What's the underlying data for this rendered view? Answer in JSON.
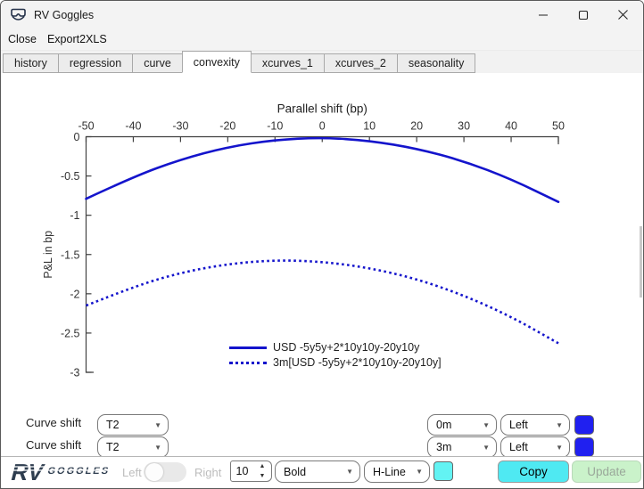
{
  "window": {
    "title": "RV Goggles"
  },
  "menu": {
    "items": [
      {
        "label": "Close"
      },
      {
        "label": "Export2XLS"
      }
    ]
  },
  "tabs": {
    "active_index": 3,
    "items": [
      {
        "label": "history"
      },
      {
        "label": "regression"
      },
      {
        "label": "curve"
      },
      {
        "label": "convexity"
      },
      {
        "label": "xcurves_1"
      },
      {
        "label": "xcurves_2"
      },
      {
        "label": "seasonality"
      }
    ]
  },
  "chart_data": {
    "type": "line",
    "title": "Parallel shift (bp)",
    "xlabel": "Parallel shift (bp)",
    "ylabel": "P&L in bp",
    "x_axis_position": "top",
    "grid": false,
    "xlim": [
      -50,
      50
    ],
    "ylim": [
      -3,
      0
    ],
    "xticks": [
      -50,
      -40,
      -30,
      -20,
      -10,
      0,
      10,
      20,
      30,
      40,
      50
    ],
    "yticks": [
      0,
      -0.5,
      -1,
      -1.5,
      -2,
      -2.5,
      -3
    ],
    "x": [
      -50,
      -40,
      -30,
      -20,
      -10,
      0,
      10,
      20,
      30,
      40,
      50
    ],
    "series": [
      {
        "name": "USD -5y5y+2*10y10y-20y10y",
        "style": "solid",
        "color": "#1414cc",
        "values": [
          -0.79,
          -0.51,
          -0.29,
          -0.13,
          -0.04,
          -0.01,
          -0.05,
          -0.15,
          -0.31,
          -0.54,
          -0.83
        ]
      },
      {
        "name": "3m[USD -5y5y+2*10y10y-20y10y]",
        "style": "dotted",
        "color": "#1414cc",
        "values": [
          -2.15,
          -1.91,
          -1.73,
          -1.62,
          -1.57,
          -1.59,
          -1.67,
          -1.81,
          -2.02,
          -2.29,
          -2.63
        ]
      }
    ],
    "legend_position": "inside-bottom-center"
  },
  "controls": {
    "rows": [
      {
        "label": "Curve shift",
        "curve": "T2",
        "tenor": "0m",
        "side": "Left",
        "color": "#2020f0"
      },
      {
        "label": "Curve shift",
        "curve": "T2",
        "tenor": "3m",
        "side": "Left",
        "color": "#2020f0"
      }
    ]
  },
  "footer": {
    "logo": {
      "rv": "RV",
      "goggles": "GOGGLES"
    },
    "toggle": {
      "left_label": "Left",
      "right_label": "Right",
      "state": "left"
    },
    "font_size": "10",
    "font_weight": "Bold",
    "line_style": "H-Line",
    "swatch_color": "#63f3f3",
    "copy_label": "Copy",
    "update_label": "Update"
  },
  "icons": {
    "dropdown_arrow": "▼",
    "spinner_up": "▲",
    "spinner_down": "▼"
  }
}
